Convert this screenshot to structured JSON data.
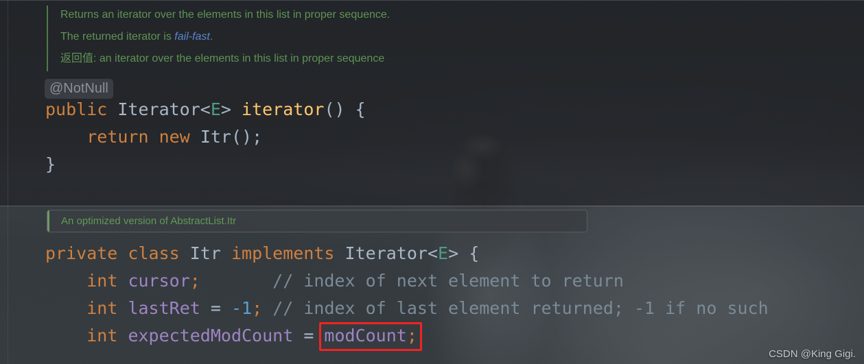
{
  "editor": {
    "language": "java",
    "theme": "darcula-with-wallpaper"
  },
  "javadoc": {
    "line1": "Returns an iterator over the elements in this list in proper sequence.",
    "line2_prefix": "The returned iterator is ",
    "line2_link": "fail-fast",
    "line2_suffix": ".",
    "line3": "返回值: an iterator over the elements in this list in proper sequence"
  },
  "inlay_hint": {
    "label": "@NotNull"
  },
  "top_code": {
    "line1": {
      "kw_public": "public",
      "space1": " ",
      "type_iterator": "Iterator",
      "lt": "<",
      "generic_e": "E",
      "gt": "> ",
      "method": "iterator",
      "tail": "() {"
    },
    "line2": {
      "indent": "    ",
      "kw_return": "return",
      "space1": " ",
      "kw_new": "new",
      "space2": " ",
      "type_itr": "Itr",
      "tail": "();"
    },
    "line3": {
      "close": "}"
    }
  },
  "doc_popup": {
    "text": "An optimized version of AbstractList.Itr"
  },
  "bottom_code": {
    "line1": {
      "kw_private": "private",
      "space1": " ",
      "kw_class": "class",
      "space2": " ",
      "type_itr": "Itr",
      "space3": " ",
      "kw_implements": "implements",
      "space4": " ",
      "type_iterator": "Iterator",
      "lt": "<",
      "generic_e": "E",
      "tail": "> {"
    },
    "line2": {
      "indent": "    ",
      "kw_int": "int",
      "space1": " ",
      "field": "cursor",
      "semi": ";",
      "gap": "       ",
      "comment": "// index of next element to return"
    },
    "line3": {
      "indent": "    ",
      "kw_int": "int",
      "space1": " ",
      "field": "lastRet",
      "eq": " = ",
      "minus": "-",
      "num": "1",
      "semi": "; ",
      "comment": "// index of last element returned; -1 if no such"
    },
    "line4": {
      "indent": "    ",
      "kw_int": "int",
      "space1": " ",
      "field": "expectedModCount",
      "eq": " = ",
      "field2": "modCount",
      "semi": ";"
    }
  },
  "annotation": {
    "highlight_color": "#f42222",
    "highlight_target": "modCount;"
  },
  "watermark": {
    "text": "CSDN @King Gigi."
  }
}
